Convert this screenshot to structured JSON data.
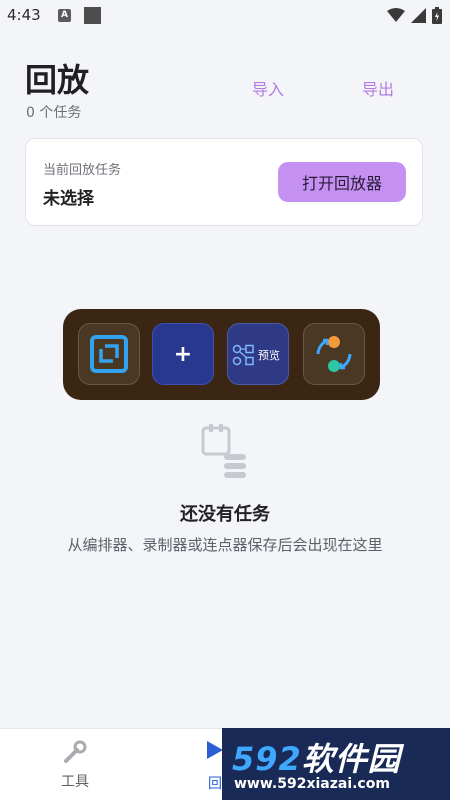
{
  "status_bar": {
    "time": "4:43",
    "notif_icon": "A"
  },
  "header": {
    "title": "回放",
    "task_count": "0 个任务",
    "import_label": "导入",
    "export_label": "导出"
  },
  "current_task": {
    "label": "当前回放任务",
    "value": "未选择",
    "open_button": "打开回放器"
  },
  "dock": {
    "add_label": "+",
    "preview_label": "预览"
  },
  "empty_state": {
    "title": "还没有任务",
    "description": "从编排器、录制器或连点器保存后会出现在这里"
  },
  "bottom_nav": {
    "tools_label": "工具",
    "replay_label": "回"
  },
  "watermark": {
    "main_num": "592",
    "main_text": "软件园",
    "url": "www.592xiazai.com"
  },
  "colors": {
    "accent": "#c490f1",
    "link": "#b27ce2",
    "dock_bg": "#3a2612"
  }
}
